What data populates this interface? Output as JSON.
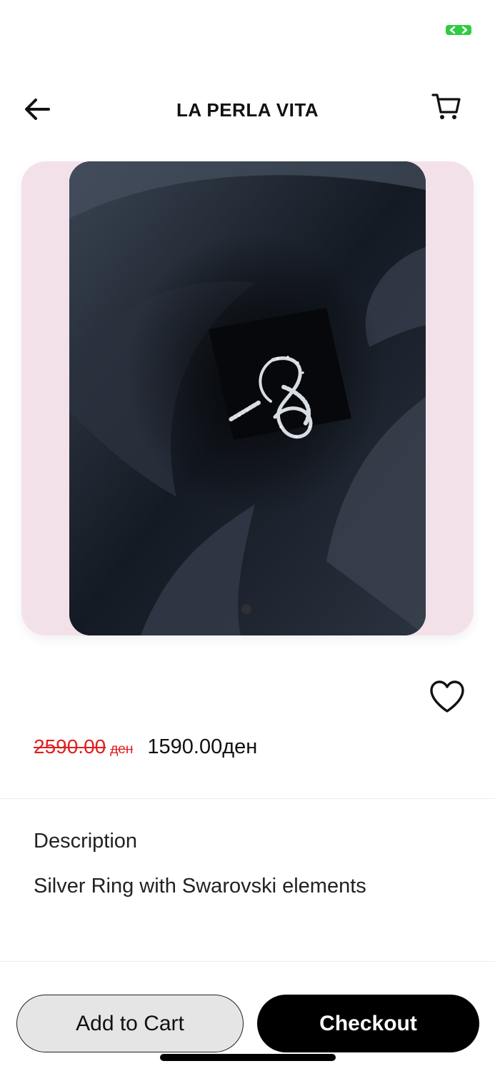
{
  "status": {
    "indicator_icon": "camera-active-icon",
    "indicator_color": "#2ecc40"
  },
  "header": {
    "title": "LA PERLA VITA",
    "back_icon": "arrow-left-icon",
    "cart_icon": "cart-icon"
  },
  "product": {
    "image_icon": "silver-ring-photo",
    "card_background": "#f3e1ea",
    "carousel_page": 1,
    "carousel_total": 1,
    "favorite_icon": "heart-outline-icon",
    "old_price": "2590.00",
    "old_currency": "ден",
    "new_price": "1590.00ден",
    "old_price_color": "#e02020"
  },
  "description": {
    "title": "Description",
    "text": "Silver Ring with Swarovski elements"
  },
  "actions": {
    "add_to_cart_label": "Add to Cart",
    "checkout_label": "Checkout"
  }
}
